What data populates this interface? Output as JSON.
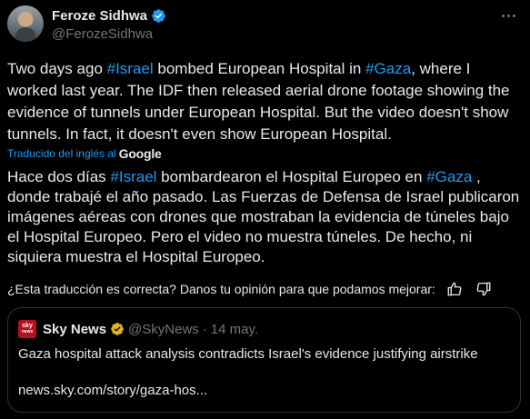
{
  "author": {
    "name": "Feroze Sidhwa",
    "handle": "@FerozeSidhwa"
  },
  "tweet": {
    "parts": [
      {
        "text": "Two days ago ",
        "tag": false
      },
      {
        "text": "#Israel",
        "tag": true
      },
      {
        "text": " bombed European Hospital in ",
        "tag": false
      },
      {
        "text": "#Gaza",
        "tag": true
      },
      {
        "text": ", where I worked last year. The IDF then released aerial drone footage showing the evidence of tunnels under European Hospital. But the video doesn't show tunnels. In fact, it doesn't even show European Hospital.",
        "tag": false
      }
    ]
  },
  "translation": {
    "label": "Traducido del inglés al",
    "provider": "Google",
    "parts": [
      {
        "text": "Hace dos días ",
        "tag": false
      },
      {
        "text": "#Israel",
        "tag": true
      },
      {
        "text": " bombardearon el Hospital Europeo en ",
        "tag": false
      },
      {
        "text": "#Gaza",
        "tag": true
      },
      {
        "text": " , donde trabajé el año pasado. Las Fuerzas de Defensa de Israel publicaron imágenes aéreas con drones que mostraban la evidencia de túneles bajo el Hospital Europeo. Pero el video no muestra túneles. De hecho, ni siquiera muestra el Hospital Europeo.",
        "tag": false
      }
    ],
    "feedback_question": "¿Esta traducción es correcta? Danos tu opinión para que podamos mejorar:"
  },
  "quote": {
    "logo_top": "sky",
    "logo_bottom": "news",
    "name": "Sky News",
    "handle": "@SkyNews",
    "separator": "·",
    "date": "14 may.",
    "title": "Gaza hospital attack analysis contradicts Israel's evidence justifying airstrike",
    "link": "news.sky.com/story/gaza-hos..."
  },
  "icons": {
    "verified": "verified-badge-icon",
    "gold_verified": "gold-verified-badge-icon",
    "more": "more-options-icon",
    "thumbs_up": "thumbs-up-icon",
    "thumbs_down": "thumbs-down-icon"
  },
  "colors": {
    "background": "#000000",
    "text": "#e7e9ea",
    "secondary": "#71767b",
    "accent": "#1d9bf0",
    "gold": "#e2b719",
    "sky_red": "#b3121e",
    "border": "#2f3336"
  }
}
